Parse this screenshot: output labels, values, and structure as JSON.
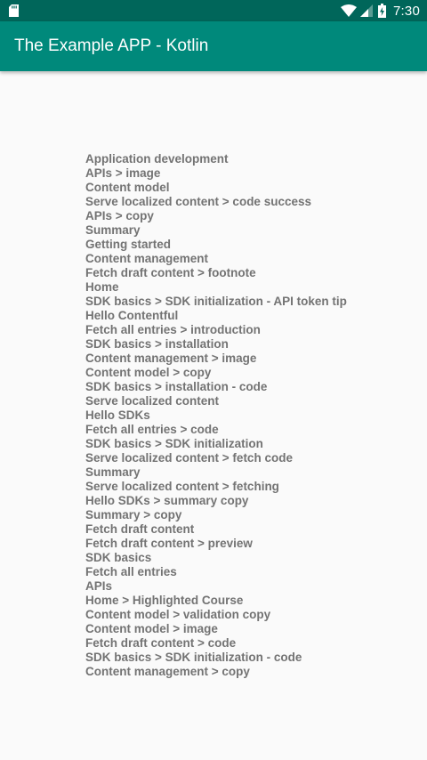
{
  "status_bar": {
    "time": "7:30",
    "icons": [
      "sd-card-icon",
      "wifi-icon",
      "signal-icon",
      "battery-charging-icon"
    ],
    "background": "#00665a"
  },
  "app_bar": {
    "title": "The Example APP - Kotlin",
    "background": "#00897b"
  },
  "entries": [
    "Application development",
    "APIs > image",
    "Content model",
    "Serve localized content > code success",
    "APIs > copy",
    "Summary",
    "Getting started",
    "Content management",
    "Fetch draft content > footnote",
    "Home",
    "SDK basics > SDK initialization - API token tip",
    "Hello Contentful",
    "Fetch all entries > introduction",
    "SDK basics > installation",
    "Content management > image",
    "Content model > copy",
    "SDK basics > installation - code",
    "Serve localized content",
    "Hello SDKs",
    "Fetch all entries > code",
    "SDK basics > SDK initialization",
    "Serve localized content > fetch code",
    "Summary",
    "Serve localized content > fetching",
    "Hello SDKs > summary copy",
    "Summary > copy",
    "Fetch draft content",
    "Fetch draft content > preview",
    "SDK basics",
    "Fetch all entries",
    "APIs",
    "Home > Highlighted Course",
    "Content model > validation copy",
    "Content model > image",
    "Fetch draft content > code",
    "SDK basics > SDK initialization - code",
    "Content management > copy"
  ],
  "colors": {
    "page_background": "#fafafa",
    "entry_text": "#737373"
  }
}
